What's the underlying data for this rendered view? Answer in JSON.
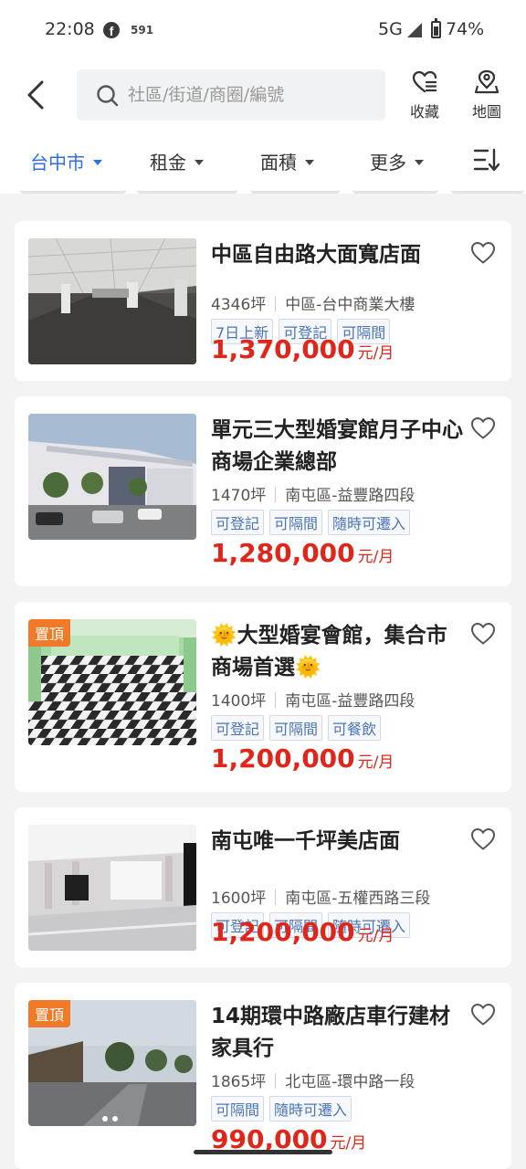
{
  "status_bar": {
    "time": "22:08",
    "fb_icon": "f",
    "app_badge": "591",
    "network": "5G",
    "battery": "74%"
  },
  "header": {
    "search_placeholder": "社區/街道/商圈/編號",
    "favorites_label": "收藏",
    "map_label": "地圖"
  },
  "filters": [
    {
      "label": "台中市",
      "active": true
    },
    {
      "label": "租金",
      "active": false
    },
    {
      "label": "面積",
      "active": false
    },
    {
      "label": "更多",
      "active": false
    }
  ],
  "listings": [
    {
      "title": "中區自由路大面寬店面",
      "area": "4346坪",
      "location": "中區-台中商業大樓",
      "tags": [
        "7日上新",
        "可登記",
        "可隔間"
      ],
      "price": "1,370,000",
      "unit": "元/月",
      "pinned": false
    },
    {
      "title": "單元三大型婚宴館月子中心商場企業總部",
      "area": "1470坪",
      "location": "南屯區-益豐路四段",
      "tags": [
        "可登記",
        "可隔間",
        "隨時可遷入"
      ],
      "price": "1,280,000",
      "unit": "元/月",
      "pinned": false
    },
    {
      "title": "🌞大型婚宴會館，集合市商場首選🌞",
      "area": "1400坪",
      "location": "南屯區-益豐路四段",
      "tags": [
        "可登記",
        "可隔間",
        "可餐飲"
      ],
      "price": "1,200,000",
      "unit": "元/月",
      "pinned": true,
      "pin_label": "置頂"
    },
    {
      "title": "南屯唯一千坪美店面",
      "area": "1600坪",
      "location": "南屯區-五權西路三段",
      "tags": [
        "可登記",
        "可隔間",
        "隨時可遷入"
      ],
      "price": "1,200,000",
      "unit": "元/月",
      "pinned": false
    },
    {
      "title": "14期環中路廠店車行建材家具行",
      "area": "1865坪",
      "location": "北屯區-環中路一段",
      "tags": [
        "可隔間",
        "隨時可遷入"
      ],
      "price": "990,000",
      "unit": "元/月",
      "pinned": true,
      "pin_label": "置頂"
    }
  ],
  "colors": {
    "accent_blue": "#2f6fe0",
    "price_red": "#e0261a",
    "pin_orange": "#f07a27"
  }
}
